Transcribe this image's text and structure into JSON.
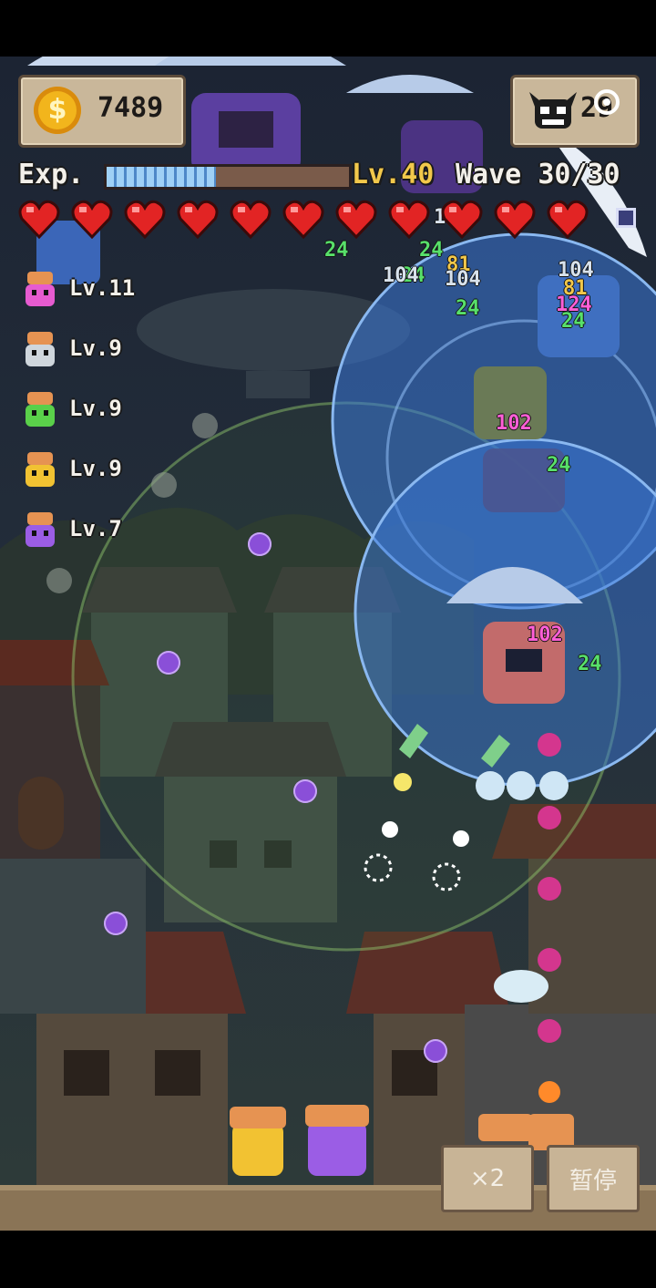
{
  "hud": {
    "coins": "7489",
    "enemy_count": "29",
    "exp_label": "Exp.",
    "level_prefix": "Lv.",
    "level_value": "40",
    "wave_label": "Wave",
    "wave_value": "30/30",
    "exp_fraction": 0.45,
    "hearts": 11
  },
  "squad": [
    {
      "level": "Lv.11",
      "color": "#e65bd0"
    },
    {
      "level": "Lv.9",
      "color": "#cfd6dc"
    },
    {
      "level": "Lv.9",
      "color": "#5ad04a"
    },
    {
      "level": "Lv.9",
      "color": "#f1c232"
    },
    {
      "level": "Lv.7",
      "color": "#9b5de5"
    }
  ],
  "damage_numbers": [
    {
      "text": "104",
      "color": "#d8e2ec"
    },
    {
      "text": "24",
      "color": "#58e06a"
    },
    {
      "text": "24",
      "color": "#58e06a"
    },
    {
      "text": "24",
      "color": "#58e06a"
    },
    {
      "text": "81",
      "color": "#f2c84b"
    },
    {
      "text": "104",
      "color": "#d8e2ec"
    },
    {
      "text": "104",
      "color": "#d8e2ec"
    },
    {
      "text": "24",
      "color": "#58e06a"
    },
    {
      "text": "104",
      "color": "#d8e2ec"
    },
    {
      "text": "81",
      "color": "#f2c84b"
    },
    {
      "text": "124",
      "color": "#ff5fd7"
    },
    {
      "text": "24",
      "color": "#58e06a"
    },
    {
      "text": "102",
      "color": "#ff5fd7"
    },
    {
      "text": "24",
      "color": "#58e06a"
    },
    {
      "text": "102",
      "color": "#ff5fd7"
    },
    {
      "text": "24",
      "color": "#58e06a"
    }
  ],
  "buttons": {
    "speed": "×2",
    "pause": "暂停"
  },
  "colors": {
    "wall_panel": "#c9b79a",
    "heart": "#e22424",
    "exp_bar": "#7fb6e8",
    "blue_zone": "#3a78d8"
  }
}
